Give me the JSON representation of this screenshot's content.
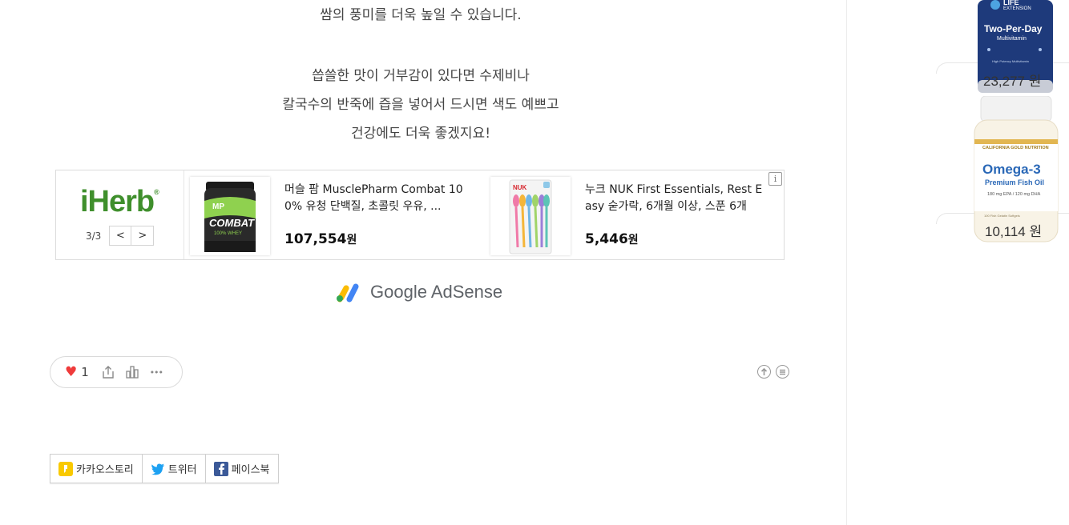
{
  "article": {
    "line1": "쌈의 풍미를 더욱 높일 수 있습니다.",
    "para2": [
      "씁쓸한 맛이 거부감이 있다면 수제비나",
      "칼국수의 반죽에 즙을 넣어서 드시면 색도 예쁘고",
      "건강에도 더욱 좋겠지요!"
    ]
  },
  "ad": {
    "brand": "iHerb",
    "brand_mark": "®",
    "pager": {
      "count": "3/3",
      "prev": "<",
      "next": ">"
    },
    "info": "i",
    "products": [
      {
        "name": "머슬 팜 MusclePharm Combat 100% 유청 단백질, 초콜릿 우유, ...",
        "price": "107,554",
        "currency": "원",
        "thumb_label_1": "MP",
        "thumb_label_2": "COMBAT",
        "thumb_label_3": "100% WHEY"
      },
      {
        "name": "누크 NUK First Essentials, Rest Easy 숟가락, 6개월 이상, 스푼 6개",
        "price": "5,446",
        "currency": "원",
        "thumb_label_1": "NUK"
      }
    ]
  },
  "adsense": {
    "label": "Google AdSense"
  },
  "reactions": {
    "likes": "1",
    "heart": "♥",
    "more": "•••"
  },
  "share": [
    {
      "label": "카카오스토리",
      "icon": "kakaostory-icon",
      "color": "#f9c900"
    },
    {
      "label": "트위터",
      "icon": "twitter-icon",
      "color": "#1da1f2"
    },
    {
      "label": "페이스북",
      "icon": "facebook-icon",
      "color": "#3b5998"
    }
  ],
  "sidebar": {
    "items": [
      {
        "price": "23,277 원",
        "label_1": "LIFE",
        "label_2": "EXTENSION",
        "label_3": "Two-Per-Day",
        "label_4": "Multivitamin",
        "label_5": "High Potency Multivitamin"
      },
      {
        "price": "10,114 원",
        "label_1": "CALIFORNIA GOLD NUTRITION",
        "label_2": "Omega-3",
        "label_3": "Premium Fish Oil",
        "label_4": "180 mg EPA / 120 mg DHA",
        "label_5": "100 Fish Gelatin Softgels"
      }
    ]
  },
  "colors": {
    "iherb_green": "#3f8f2c",
    "heart_red": "#ef3b3b",
    "text_gray": "#444444"
  }
}
